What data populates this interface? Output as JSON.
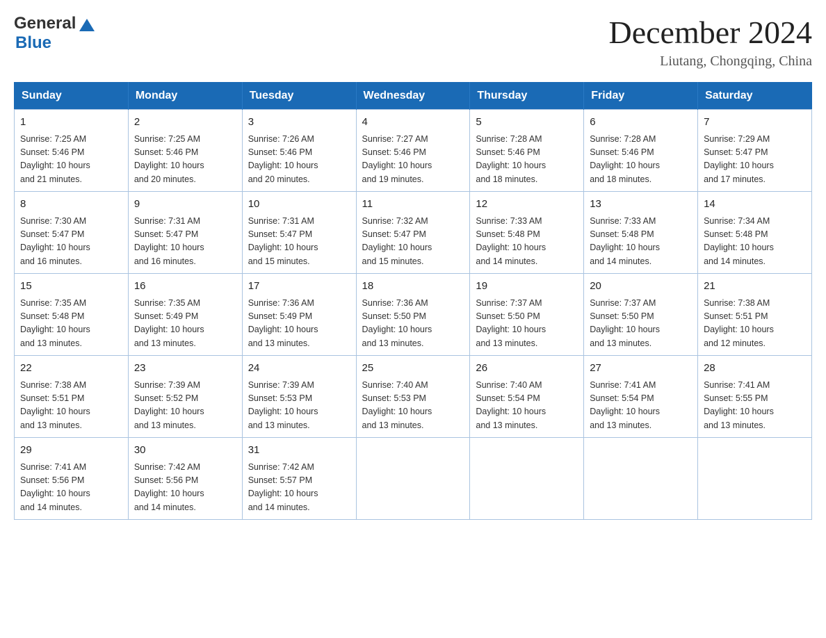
{
  "header": {
    "logo": {
      "general": "General",
      "blue": "Blue"
    },
    "title": "December 2024",
    "subtitle": "Liutang, Chongqing, China"
  },
  "calendar": {
    "days_of_week": [
      "Sunday",
      "Monday",
      "Tuesday",
      "Wednesday",
      "Thursday",
      "Friday",
      "Saturday"
    ],
    "weeks": [
      [
        {
          "day": "1",
          "sunrise": "7:25 AM",
          "sunset": "5:46 PM",
          "daylight": "10 hours and 21 minutes."
        },
        {
          "day": "2",
          "sunrise": "7:25 AM",
          "sunset": "5:46 PM",
          "daylight": "10 hours and 20 minutes."
        },
        {
          "day": "3",
          "sunrise": "7:26 AM",
          "sunset": "5:46 PM",
          "daylight": "10 hours and 20 minutes."
        },
        {
          "day": "4",
          "sunrise": "7:27 AM",
          "sunset": "5:46 PM",
          "daylight": "10 hours and 19 minutes."
        },
        {
          "day": "5",
          "sunrise": "7:28 AM",
          "sunset": "5:46 PM",
          "daylight": "10 hours and 18 minutes."
        },
        {
          "day": "6",
          "sunrise": "7:28 AM",
          "sunset": "5:46 PM",
          "daylight": "10 hours and 18 minutes."
        },
        {
          "day": "7",
          "sunrise": "7:29 AM",
          "sunset": "5:47 PM",
          "daylight": "10 hours and 17 minutes."
        }
      ],
      [
        {
          "day": "8",
          "sunrise": "7:30 AM",
          "sunset": "5:47 PM",
          "daylight": "10 hours and 16 minutes."
        },
        {
          "day": "9",
          "sunrise": "7:31 AM",
          "sunset": "5:47 PM",
          "daylight": "10 hours and 16 minutes."
        },
        {
          "day": "10",
          "sunrise": "7:31 AM",
          "sunset": "5:47 PM",
          "daylight": "10 hours and 15 minutes."
        },
        {
          "day": "11",
          "sunrise": "7:32 AM",
          "sunset": "5:47 PM",
          "daylight": "10 hours and 15 minutes."
        },
        {
          "day": "12",
          "sunrise": "7:33 AM",
          "sunset": "5:48 PM",
          "daylight": "10 hours and 14 minutes."
        },
        {
          "day": "13",
          "sunrise": "7:33 AM",
          "sunset": "5:48 PM",
          "daylight": "10 hours and 14 minutes."
        },
        {
          "day": "14",
          "sunrise": "7:34 AM",
          "sunset": "5:48 PM",
          "daylight": "10 hours and 14 minutes."
        }
      ],
      [
        {
          "day": "15",
          "sunrise": "7:35 AM",
          "sunset": "5:48 PM",
          "daylight": "10 hours and 13 minutes."
        },
        {
          "day": "16",
          "sunrise": "7:35 AM",
          "sunset": "5:49 PM",
          "daylight": "10 hours and 13 minutes."
        },
        {
          "day": "17",
          "sunrise": "7:36 AM",
          "sunset": "5:49 PM",
          "daylight": "10 hours and 13 minutes."
        },
        {
          "day": "18",
          "sunrise": "7:36 AM",
          "sunset": "5:50 PM",
          "daylight": "10 hours and 13 minutes."
        },
        {
          "day": "19",
          "sunrise": "7:37 AM",
          "sunset": "5:50 PM",
          "daylight": "10 hours and 13 minutes."
        },
        {
          "day": "20",
          "sunrise": "7:37 AM",
          "sunset": "5:50 PM",
          "daylight": "10 hours and 13 minutes."
        },
        {
          "day": "21",
          "sunrise": "7:38 AM",
          "sunset": "5:51 PM",
          "daylight": "10 hours and 12 minutes."
        }
      ],
      [
        {
          "day": "22",
          "sunrise": "7:38 AM",
          "sunset": "5:51 PM",
          "daylight": "10 hours and 13 minutes."
        },
        {
          "day": "23",
          "sunrise": "7:39 AM",
          "sunset": "5:52 PM",
          "daylight": "10 hours and 13 minutes."
        },
        {
          "day": "24",
          "sunrise": "7:39 AM",
          "sunset": "5:53 PM",
          "daylight": "10 hours and 13 minutes."
        },
        {
          "day": "25",
          "sunrise": "7:40 AM",
          "sunset": "5:53 PM",
          "daylight": "10 hours and 13 minutes."
        },
        {
          "day": "26",
          "sunrise": "7:40 AM",
          "sunset": "5:54 PM",
          "daylight": "10 hours and 13 minutes."
        },
        {
          "day": "27",
          "sunrise": "7:41 AM",
          "sunset": "5:54 PM",
          "daylight": "10 hours and 13 minutes."
        },
        {
          "day": "28",
          "sunrise": "7:41 AM",
          "sunset": "5:55 PM",
          "daylight": "10 hours and 13 minutes."
        }
      ],
      [
        {
          "day": "29",
          "sunrise": "7:41 AM",
          "sunset": "5:56 PM",
          "daylight": "10 hours and 14 minutes."
        },
        {
          "day": "30",
          "sunrise": "7:42 AM",
          "sunset": "5:56 PM",
          "daylight": "10 hours and 14 minutes."
        },
        {
          "day": "31",
          "sunrise": "7:42 AM",
          "sunset": "5:57 PM",
          "daylight": "10 hours and 14 minutes."
        },
        null,
        null,
        null,
        null
      ]
    ],
    "labels": {
      "sunrise": "Sunrise:",
      "sunset": "Sunset:",
      "daylight": "Daylight:"
    }
  }
}
